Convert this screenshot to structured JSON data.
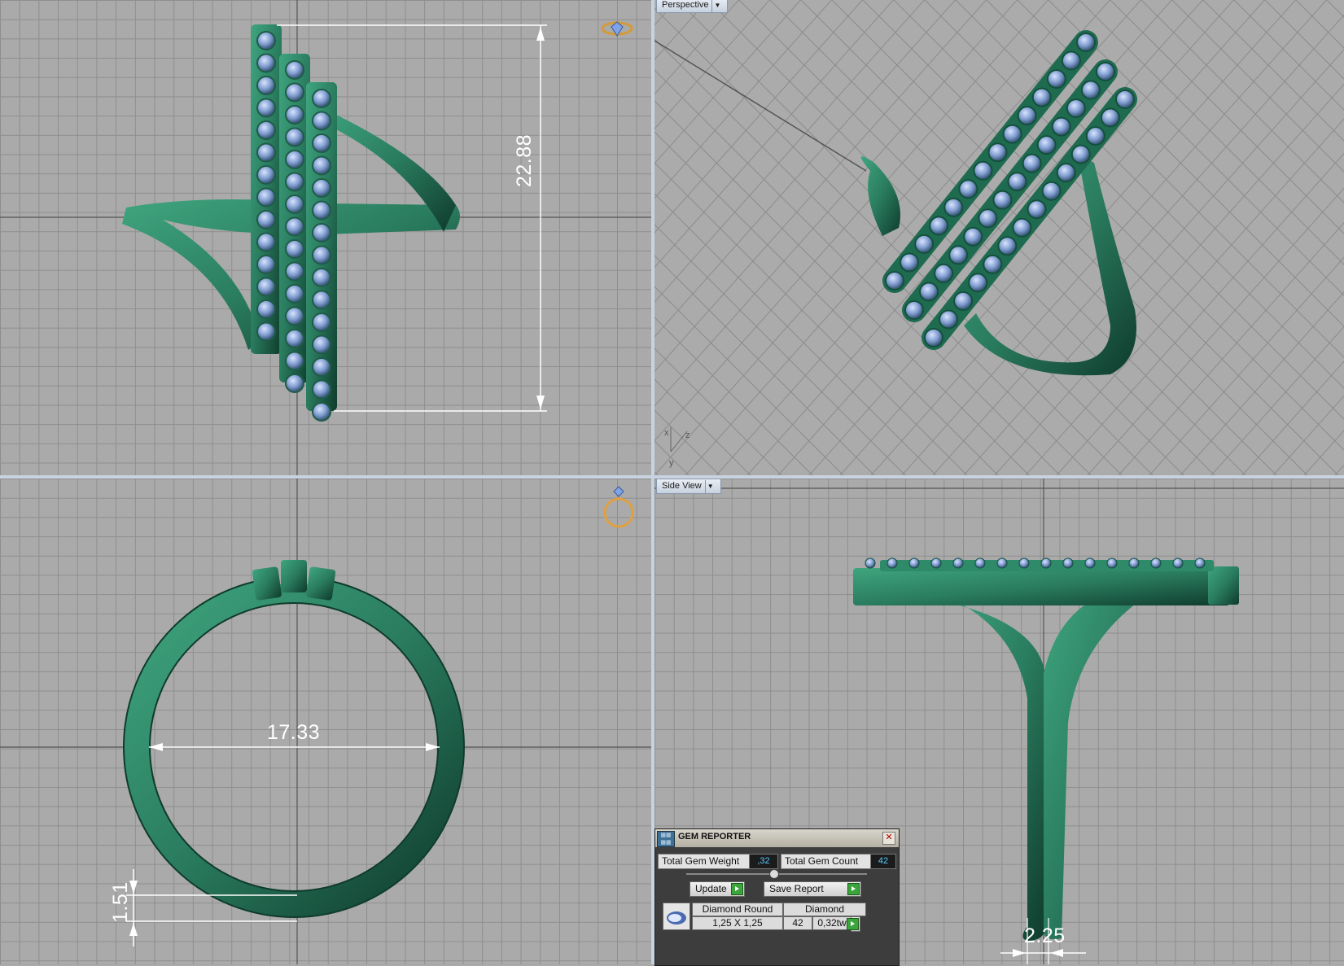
{
  "viewports": {
    "perspective_label": "Perspective",
    "side_label": "Side View"
  },
  "dimensions": {
    "top_height": "22.88",
    "ring_inner": "17.33",
    "band_thickness": "1.51",
    "shank_width": "2.25"
  },
  "axis": {
    "x": "x",
    "y": "y",
    "z": "z"
  },
  "gem_reporter": {
    "title": "GEM REPORTER",
    "total_weight_label": "Total Gem Weight",
    "total_weight_value": ",32",
    "total_count_label": "Total Gem Count",
    "total_count_value": "42",
    "update_label": "Update",
    "save_report_label": "Save Report",
    "row": {
      "shape": "Diamond Round",
      "material": "Diamond",
      "size": "1,25 X 1,25",
      "count": "42",
      "weight": "0,32tw"
    }
  },
  "colors": {
    "metal": "#2e8a69",
    "gem": "#8fa8d6",
    "viewport_bg": "#aaaaaa",
    "grid_line": "#8e8e8e"
  },
  "icons": [
    "diamond-ring-icon",
    "ring-icon",
    "dropdown-icon",
    "close-icon",
    "play-icon"
  ]
}
